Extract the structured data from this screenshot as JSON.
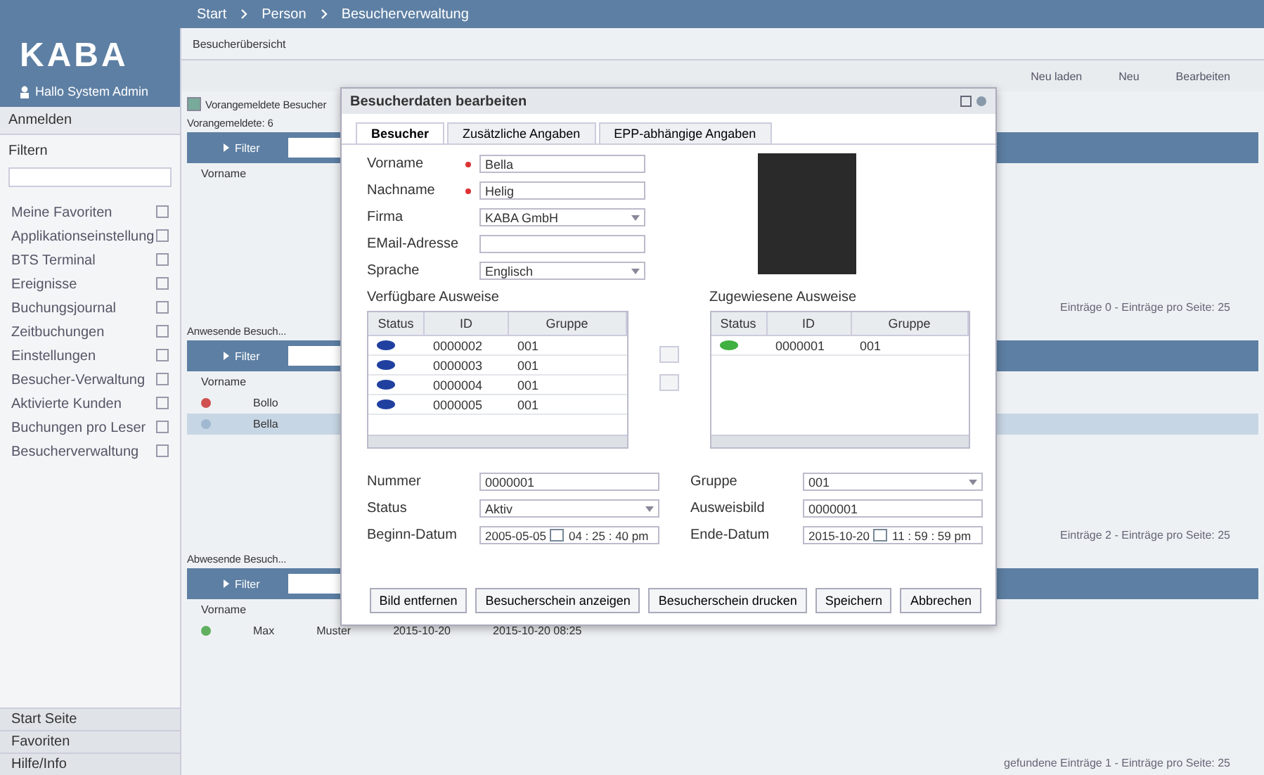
{
  "breadcrumb": [
    "Start",
    "Person",
    "Besucherverwaltung"
  ],
  "logo": "KABA",
  "user": "Hallo System Admin",
  "sidebar": {
    "header": "Anmelden",
    "filter_label": "Filtern",
    "items": [
      "Meine Favoriten",
      "Applikationseinstellung",
      "BTS Terminal",
      "Ereignisse",
      "Buchungsjournal",
      "Zeitbuchungen",
      "Einstellungen",
      "Besucher-Verwaltung",
      "Aktivierte Kunden",
      "Buchungen pro Leser",
      "Besucherverwaltung"
    ],
    "footer": [
      "Start Seite",
      "Favoriten",
      "Hilfe/Info"
    ]
  },
  "main": {
    "tab": "Besucherübersicht",
    "toolbar": [
      "Neu laden",
      "Neu",
      "Bearbeiten"
    ],
    "sections": [
      {
        "title": "Vorangemeldete Besucher",
        "checked": true,
        "subtitle": "Vorangemeldete: 6",
        "filter": "Filter",
        "columns": [
          "Vorname"
        ],
        "pager": "Einträge 0 - Einträge pro Seite: 25"
      },
      {
        "title": "Anwesende Besuch...",
        "filter": "Filter",
        "columns": [
          "Vorname"
        ],
        "rows": [
          {
            "color": "#d05050",
            "cells": [
              "Bollo"
            ],
            "selected": false
          },
          {
            "color": "#a0b8d0",
            "cells": [
              "Bella"
            ],
            "selected": true
          }
        ],
        "pager": "Einträge 2 - Einträge pro Seite: 25"
      },
      {
        "title": "Abwesende Besuch...",
        "filter": "Filter",
        "columns": [
          "Vorname"
        ],
        "rows": [
          {
            "color": "#60b060",
            "cells": [
              "Max",
              "Muster",
              "2015-10-20",
              "2015-10-20 08:25"
            ],
            "selected": false
          }
        ],
        "pager": "gefundene Einträge 1 - Einträge pro Seite: 25"
      }
    ]
  },
  "dialog": {
    "title": "Besucherdaten bearbeiten",
    "tabs": [
      {
        "label": "Besucher",
        "selected": true
      },
      {
        "label": "Zusätzliche Angaben",
        "selected": false
      },
      {
        "label": "EPP-abhängige Angaben",
        "selected": false
      }
    ],
    "fields": [
      {
        "label": "Vorname",
        "value": "Bella",
        "required": true,
        "kind": "text"
      },
      {
        "label": "Nachname",
        "value": "Helig",
        "required": true,
        "kind": "text"
      },
      {
        "label": "Firma",
        "value": "KABA GmbH",
        "required": false,
        "kind": "select"
      },
      {
        "label": "EMail-Adresse",
        "required": false,
        "kind": "text"
      },
      {
        "label": "Sprache",
        "value": "Englisch",
        "required": false,
        "kind": "select"
      }
    ],
    "available": {
      "title": "Verfügbare Ausweise",
      "columns": [
        "Status",
        "ID",
        "Gruppe"
      ],
      "rows": [
        {
          "color": "#2040a0",
          "id": "0000002",
          "group": "001"
        },
        {
          "color": "#2040a0",
          "id": "0000003",
          "group": "001"
        },
        {
          "color": "#2040a0",
          "id": "0000004",
          "group": "001"
        },
        {
          "color": "#2040a0",
          "id": "0000005",
          "group": "001"
        }
      ]
    },
    "assigned": {
      "title": "Zugewiesene Ausweise",
      "columns": [
        "Status",
        "ID",
        "Gruppe"
      ],
      "rows": [
        {
          "color": "#40b040",
          "id": "0000001",
          "group": "001"
        }
      ]
    },
    "lower_left": [
      {
        "label": "Nummer",
        "value": "0000001",
        "kind": "text"
      },
      {
        "label": "Status",
        "value": "Aktiv",
        "kind": "select"
      },
      {
        "label": "Beginn-Datum",
        "date": "2005-05-05",
        "time": "04 : 25 : 40 pm",
        "kind": "datetime"
      }
    ],
    "lower_right": [
      {
        "label": "Gruppe",
        "value": "001",
        "kind": "select"
      },
      {
        "label": "Ausweisbild",
        "value": "0000001",
        "kind": "text"
      },
      {
        "label": "Ende-Datum",
        "date": "2015-10-20",
        "time": "11 : 59 : 59 pm",
        "kind": "datetime"
      }
    ],
    "buttons": [
      "Bild entfernen",
      "Besucherschein anzeigen",
      "Besucherschein drucken",
      "Speichern",
      "Abbrechen"
    ]
  }
}
